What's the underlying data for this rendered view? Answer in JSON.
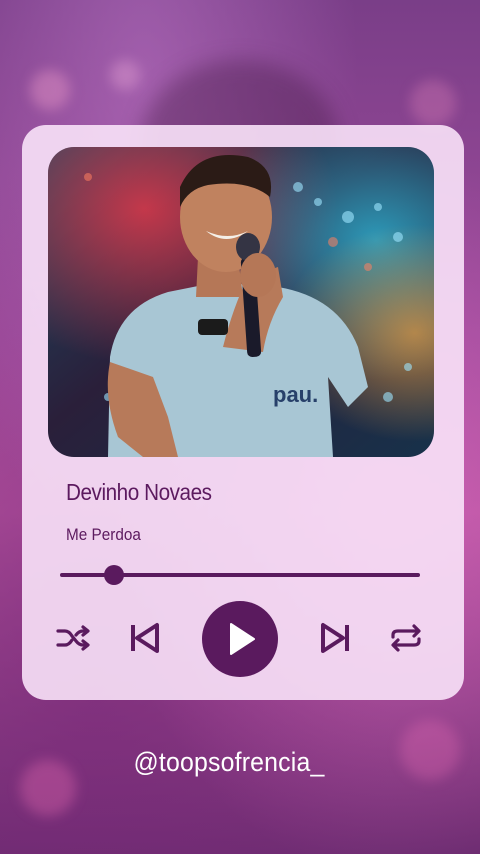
{
  "player": {
    "artist": "Devinho Novaes",
    "song": "Me Perdoa",
    "progress_fraction": 0.15,
    "accent_color": "#5a1a5e"
  },
  "icons": {
    "shuffle": "shuffle-icon",
    "previous": "skip-previous-icon",
    "play": "play-icon",
    "next": "skip-next-icon",
    "repeat": "repeat-icon"
  },
  "footer": {
    "handle": "@toopsofrencia_"
  }
}
